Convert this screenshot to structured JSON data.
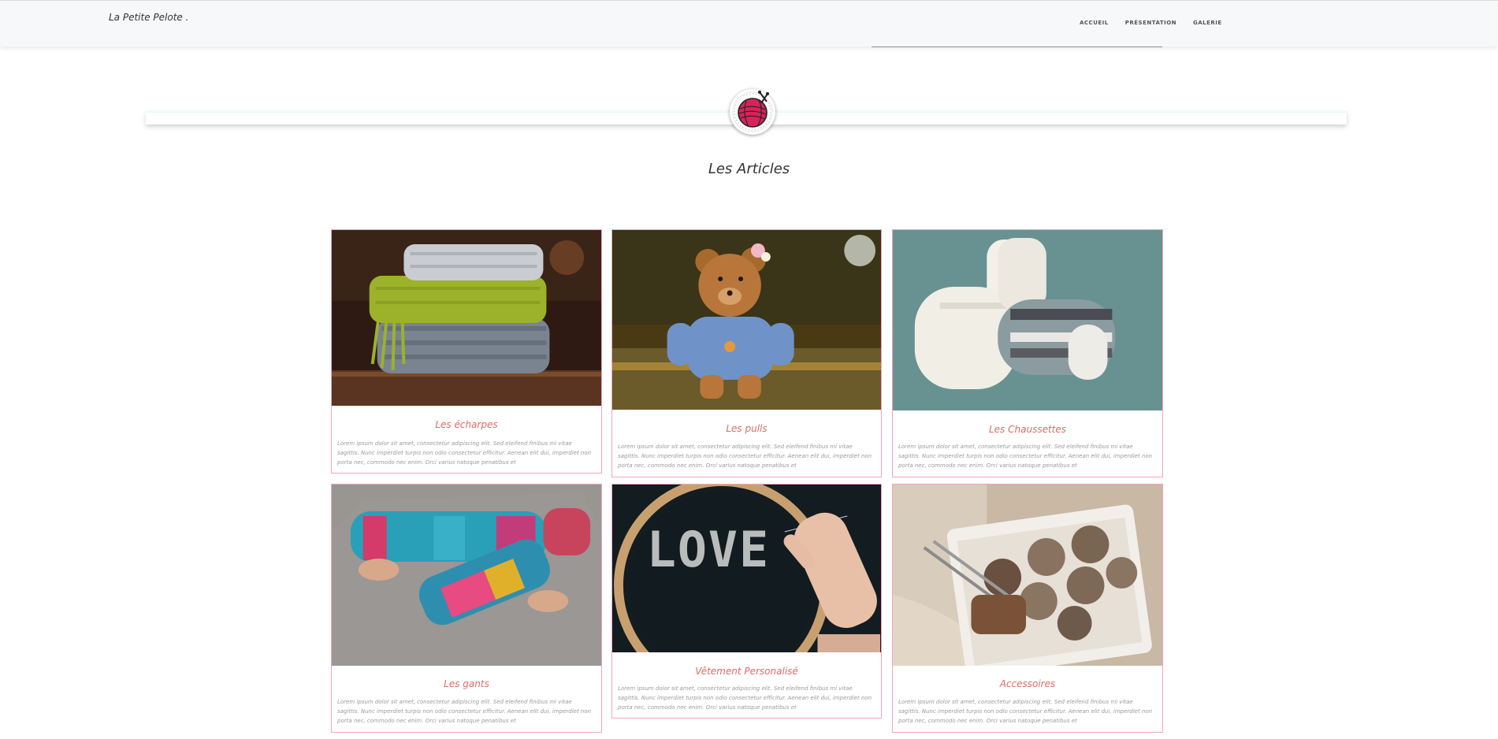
{
  "navbar": {
    "brand": "La Petite Pelote .",
    "links": [
      "ACCUEIL",
      "PRÉSENTATION",
      "GALERIE"
    ]
  },
  "logo": {
    "icon": "yarn-ball-icon",
    "color": "#d6245a"
  },
  "section": {
    "title": "Les Articles"
  },
  "articles": [
    {
      "title": "Les écharpes",
      "text": "Lorem ipsum dolor sit amet, consectetur adipiscing elit. Sed eleifend finibus mi vitae sagittis. Nunc imperdiet turpis non odio consectetur efficitur. Aenean elit dui, imperdiet non porta nec, commodo nec enim. Orci varius natoque penatibus et",
      "image": "stacked-knitted-scarves-photo"
    },
    {
      "title": "Les pulls",
      "text": "Lorem ipsum dolor sit amet, consectetur adipiscing elit. Sed eleifend finibus mi vitae sagittis. Nunc imperdiet turpis non odio consectetur efficitur. Aenean elit dui, imperdiet non porta nec, commodo nec enim. Orci varius natoque penatibus et",
      "image": "teddy-bear-in-sweater-photo"
    },
    {
      "title": "Les Chaussettes",
      "text": "Lorem ipsum dolor sit amet, consectetur adipiscing elit. Sed eleifend finibus mi vitae sagittis. Nunc imperdiet turpis non odio consectetur efficitur. Aenean elit dui, imperdiet non porta nec, commodo nec enim. Orci varius natoque penatibus et",
      "image": "knitted-baby-socks-photo"
    },
    {
      "title": "Les gants",
      "text": "Lorem ipsum dolor sit amet, consectetur adipiscing elit. Sed eleifend finibus mi vitae sagittis. Nunc imperdiet turpis non odio consectetur efficitur. Aenean elit dui, imperdiet non porta nec, commodo nec enim. Orci varius natoque penatibus et",
      "image": "fingerless-gloves-photo"
    },
    {
      "title": "Vêtement Personalisé",
      "text": "Lorem ipsum dolor sit amet, consectetur adipiscing elit. Sed eleifend finibus mi vitae sagittis. Nunc imperdiet turpis non odio consectetur efficitur. Aenean elit dui, imperdiet non porta nec, commodo nec enim. Orci varius natoque penatibus et",
      "image": "embroidery-hoop-love-photo"
    },
    {
      "title": "Accessoires",
      "text": "Lorem ipsum dolor sit amet, consectetur adipiscing elit. Sed eleifend finibus mi vitae sagittis. Nunc imperdiet turpis non odio consectetur efficitur. Aenean elit dui, imperdiet non porta nec, commodo nec enim. Orci varius natoque penatibus et",
      "image": "yarn-basket-photo"
    }
  ],
  "colors": {
    "card_border": "#f2a4bd",
    "card_title": "#e06a66",
    "body_text": "#9a9a9a",
    "navbar_bg": "#f7f8f9"
  }
}
